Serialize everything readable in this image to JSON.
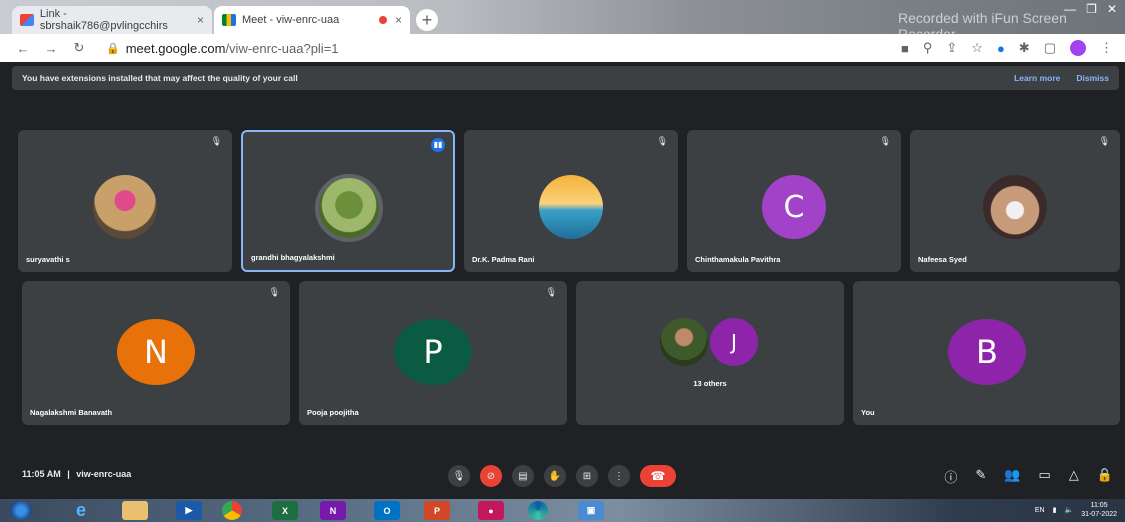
{
  "browser": {
    "tabs": [
      {
        "label": "Link - sbrshaik786@pvlingcchirs",
        "close": "×"
      },
      {
        "label": "Meet - viw-enrc-uaa",
        "close": "×"
      }
    ],
    "new_tab": "+",
    "recording_watermark": "Recorded with iFun Screen Recorder",
    "url_host": "meet.google.com",
    "url_path": "/viw-enrc-uaa?pli=1",
    "window_buttons": [
      "—",
      "❐",
      "✕"
    ]
  },
  "banner": {
    "text": "You have extensions installed that may affect the quality of your call",
    "learn_more": "Learn more",
    "dismiss": "Dismiss"
  },
  "participants": [
    {
      "name": "suryavathi s",
      "avatar_type": "photo",
      "photo_color": "#c9a06a"
    },
    {
      "name": "grandhi bhagyalakshmi",
      "avatar_type": "photo",
      "photo_color": "#7a9a4e",
      "speaking": true
    },
    {
      "name": "Dr.K. Padma Rani",
      "avatar_type": "photo",
      "photo_color": "#f5a623"
    },
    {
      "name": "Chinthamakula Pavithra",
      "avatar_type": "letter",
      "letter": "C",
      "color": "#a142c9"
    },
    {
      "name": "Nafeesa Syed",
      "avatar_type": "photo",
      "photo_color": "#d7c1c7"
    },
    {
      "name": "Nagalakshmi Banavath",
      "avatar_type": "letter",
      "letter": "N",
      "color": "#e8710a"
    },
    {
      "name": "Pooja poojitha",
      "avatar_type": "letter",
      "letter": "P",
      "color": "#0b5b43"
    },
    {
      "name": "13 others",
      "avatar_type": "group",
      "letter": "J",
      "color": "#8e24aa"
    },
    {
      "name": "You",
      "avatar_type": "letter",
      "letter": "B",
      "color": "#8e24aa"
    }
  ],
  "bottom": {
    "time": "11:05 AM",
    "separator": "|",
    "meeting_code": "viw-enrc-uaa"
  },
  "taskbar": {
    "clock_time": "11:05",
    "clock_date": "31-07-2022",
    "lang": "EN"
  },
  "colors": {
    "background": "#202124",
    "tile": "#3c4043",
    "accent": "#8ab4f8",
    "danger": "#ea4335"
  }
}
